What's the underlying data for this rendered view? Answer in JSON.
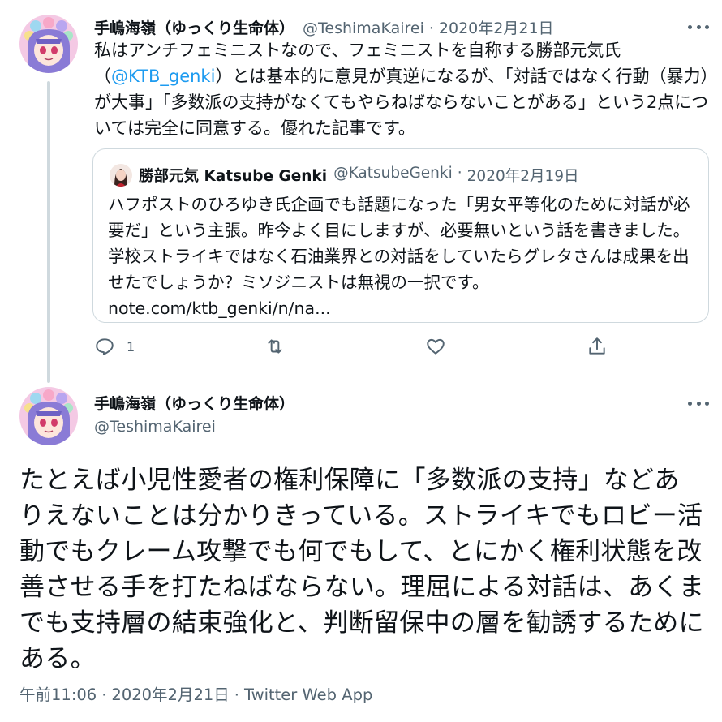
{
  "tweet1": {
    "author_name": "手嶋海嶺（ゆっくり生命体）",
    "handle": "@TeshimaKairei",
    "date": "2020年2月21日",
    "text_before": "私はアンチフェミニストなので、フェミニストを自称する勝部元気氏（",
    "mention": "@KTB_genki",
    "text_after": "）とは基本的に意見が真逆になるが、「対話ではなく行動（暴力）が大事」「多数派の支持がなくてもやらねばならないことがある」という2点については完全に同意する。優れた記事です。",
    "avatar_icon": "anime-character-avatar",
    "quote": {
      "author_name": "勝部元気 Katsube Genki",
      "handle": "@KatsubeGenki",
      "date": "2020年2月19日",
      "text": "ハフポストのひろゆき氏企画でも話題になった「男女平等化のために対話が必要だ」という主張。昨今よく目にしますが、必要無いという話を書きました。学校ストライキではなく石油業界との対話をしていたらグレタさんは成果を出せたでしょうか？ミソジニストは無視の一択です。",
      "link": "note.com/ktb_genki/n/na..."
    },
    "actions": {
      "reply_count": "1",
      "reply_icon": "reply-icon",
      "retweet_icon": "retweet-icon",
      "like_icon": "like-icon",
      "share_icon": "share-icon"
    }
  },
  "tweet2": {
    "author_name": "手嶋海嶺（ゆっくり生命体）",
    "handle": "@TeshimaKairei",
    "text": "たとえば小児性愛者の権利保障に「多数派の支持」などありえないことは分かりきっている。ストライキでもロビー活動でもクレーム攻撃でも何でもして、とにかく権利状態を改善させる手を打たねばならない。理屈による対話は、あくまでも支持層の結束強化と、判断留保中の層を勧誘するためにある。",
    "time": "午前11:06",
    "date": "2020年2月21日",
    "source": "Twitter Web App",
    "separator": "·"
  },
  "colors": {
    "text": "#0f1419",
    "secondary": "#536471",
    "link": "#1d9bf0",
    "border": "#cfd9de"
  }
}
